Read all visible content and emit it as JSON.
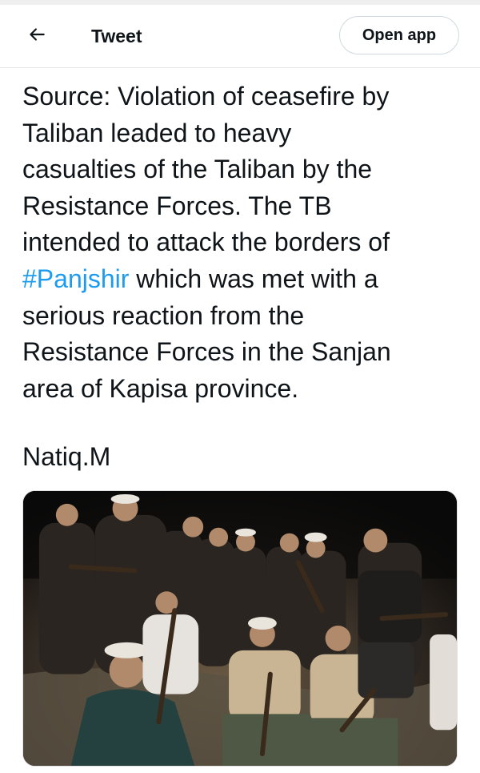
{
  "header": {
    "back_icon": "arrow-left-icon",
    "title": "Tweet",
    "open_app_label": "Open app"
  },
  "tweet": {
    "text_lines": [
      "Source: Violation of ceasefire by",
      "Taliban leaded to heavy",
      "casualties of the Taliban by the",
      "Resistance Forces. The TB",
      "intended to attack the borders of"
    ],
    "hashtag": "#Panjshir",
    "after_hashtag": " which was met with a",
    "text_lines_after": [
      "serious reaction from the",
      "Resistance Forces in the Sanjan",
      "area of Kapisa province."
    ],
    "signature": "Natiq.M"
  },
  "colors": {
    "text": "#0f1419",
    "link": "#1d9bf0",
    "border": "#cfd9de"
  }
}
